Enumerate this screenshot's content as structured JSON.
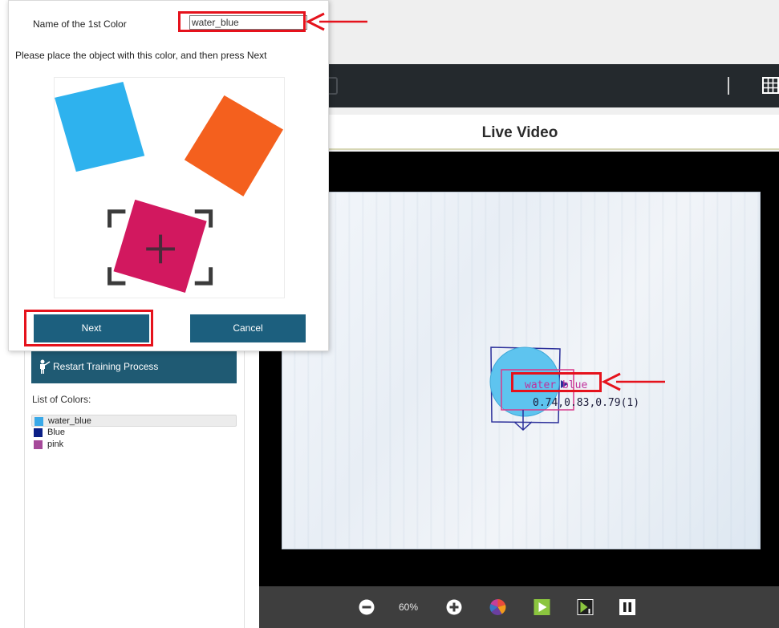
{
  "dialog": {
    "name_label": "Name of the 1st Color",
    "name_value": "water_blue",
    "instruction": "Please place the object with this color, and then press Next",
    "next_label": "Next",
    "cancel_label": "Cancel"
  },
  "sidebar": {
    "restart_label": "Restart Training Process",
    "colors_label": "List of Colors:",
    "colors": [
      {
        "name": "water_blue",
        "swatch": "#3aa9e8"
      },
      {
        "name": "Blue",
        "swatch": "#0b1f86"
      },
      {
        "name": "pink",
        "swatch": "#a64a9a"
      }
    ]
  },
  "video": {
    "title": "Live Video",
    "detection_label": "water_blue",
    "detection_values": "0.74,0.83,0.79(1)"
  },
  "controls": {
    "zoom": "60%"
  },
  "colors": {
    "accent": "#1c5f7e",
    "toolbar": "#24292d",
    "annotation": "#e5121c"
  }
}
